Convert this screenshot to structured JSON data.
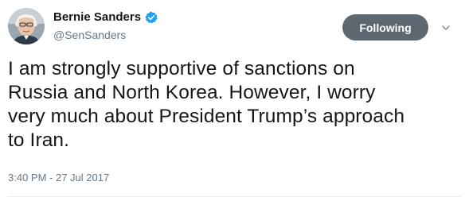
{
  "author": {
    "display_name": "Bernie Sanders",
    "handle": "@SenSanders",
    "verified": true,
    "avatar_icon": "profile-photo"
  },
  "follow_button": {
    "label": "Following",
    "color": "#5c6770"
  },
  "menu": {
    "icon": "chevron-down-icon"
  },
  "tweet": {
    "lines": [
      "I am strongly supportive of sanctions on",
      "Russia and North Korea. However, I worry",
      "very much about President Trump’s approach",
      "to Iran."
    ],
    "timestamp": "3:40 PM - 27 Jul 2017"
  },
  "colors": {
    "verified_badge": "#1da1f2",
    "text": "#14171a",
    "muted": "#657786"
  }
}
